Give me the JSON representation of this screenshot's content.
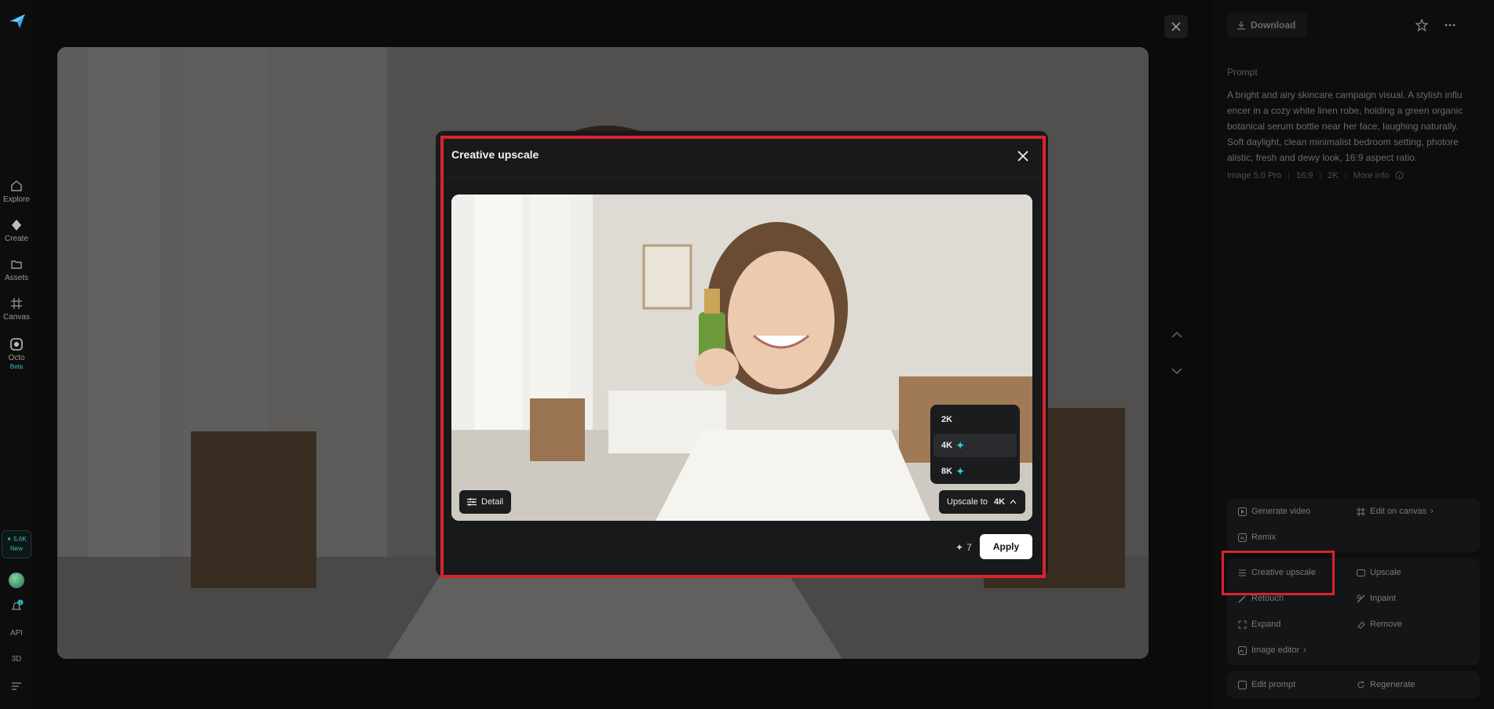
{
  "colors": {
    "accent": "#2bc0c9",
    "highlight": "#d9232e",
    "background": "#0b0b0c",
    "panel": "#141517"
  },
  "sidebar": {
    "items": [
      {
        "label": "Explore",
        "icon": "home-icon"
      },
      {
        "label": "Create",
        "icon": "diamond-icon"
      },
      {
        "label": "Assets",
        "icon": "folder-icon"
      },
      {
        "label": "Canvas",
        "icon": "canvas-icon"
      },
      {
        "label": "Octo",
        "icon": "octo-icon",
        "badge": "Beta"
      }
    ],
    "credits": {
      "value": "5.6K",
      "label": "New"
    },
    "notification_count": "1",
    "api_label": "API",
    "threed_label": "3D"
  },
  "panel": {
    "download_label": "Download",
    "prompt_label": "Prompt",
    "prompt_lines": [
      "A bright and airy skincare campaign visual. A stylish influ",
      "encer in a cozy white linen robe, holding a green organic",
      "botanical serum bottle near her face, laughing naturally.",
      "Soft daylight, clean minimalist bedroom setting, photore",
      "alistic, fresh and dewy look, 16:9 aspect ratio."
    ],
    "meta": {
      "model": "Image 5.0 Pro",
      "ratio": "16:9",
      "resolution": "2K",
      "more": "More info"
    },
    "actions": {
      "generate_video": "Generate video",
      "edit_on_canvas": "Edit on canvas",
      "remix": "Remix",
      "creative_upscale": "Creative upscale",
      "upscale": "Upscale",
      "retouch": "Retouch",
      "inpaint": "Inpaint",
      "expand": "Expand",
      "remove": "Remove",
      "image_editor": "Image editor",
      "edit_prompt": "Edit prompt",
      "regenerate": "Regenerate"
    }
  },
  "modal": {
    "title": "Creative upscale",
    "detail_label": "Detail",
    "upscale_prefix": "Upscale to",
    "upscale_value": "4K",
    "options": [
      {
        "label": "2K",
        "premium": false
      },
      {
        "label": "4K",
        "premium": true,
        "selected": true
      },
      {
        "label": "8K",
        "premium": true
      }
    ],
    "plus_glyph": "✦",
    "cost": "7",
    "apply_label": "Apply"
  }
}
